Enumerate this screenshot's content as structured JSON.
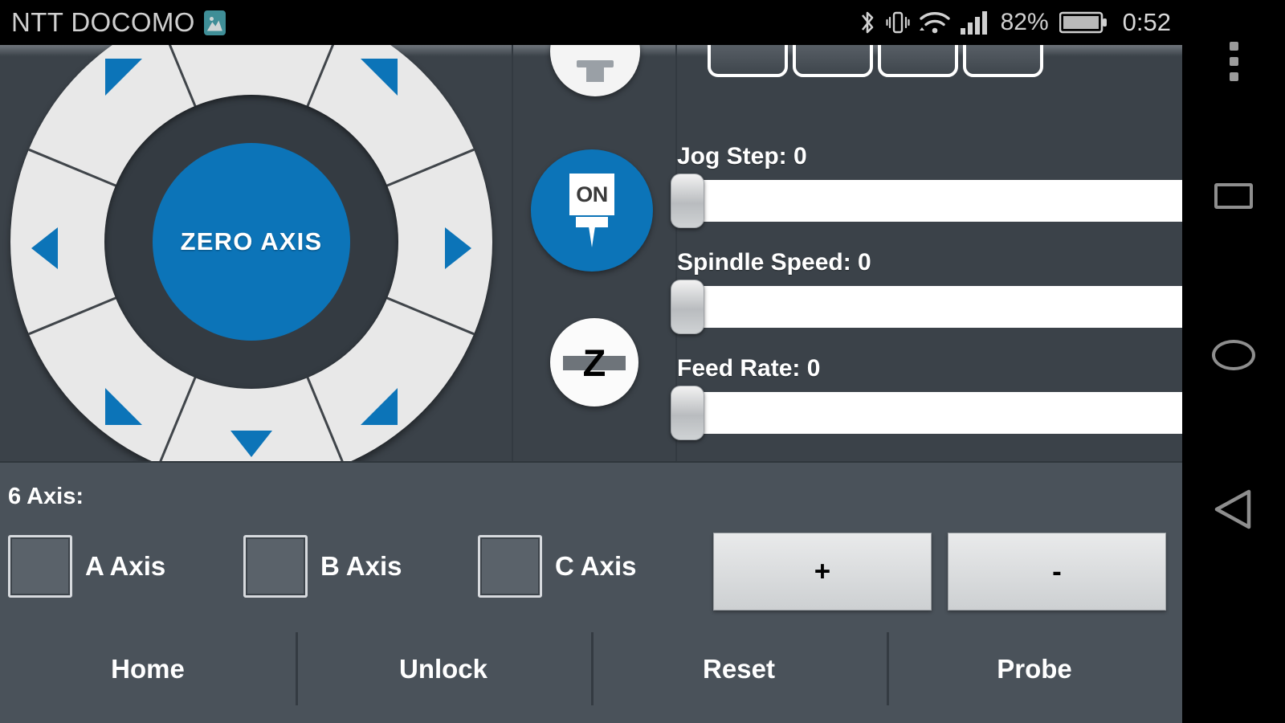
{
  "statusbar": {
    "carrier": "NTT DOCOMO",
    "battery_percent": "82%",
    "clock": "0:52",
    "icons": [
      "photo-icon",
      "bluetooth-icon",
      "vibrate-icon",
      "wifi-icon",
      "signal-icon",
      "battery-icon"
    ]
  },
  "jog_wheel": {
    "center_label": "ZERO AXIS",
    "directions": [
      "up-left",
      "up",
      "up-right",
      "left",
      "right",
      "down-left",
      "down",
      "down-right"
    ],
    "accent_color": "#0c74b8",
    "ring_color": "#e8e8e8",
    "hub_color": "#343b42"
  },
  "tool_column": {
    "tool_top_icon": "tool-change-icon",
    "spindle_label": "ON",
    "spindle_icon": "spindle-on-icon",
    "zprobe_label": "Z",
    "zprobe_icon": "z-probe-icon"
  },
  "top_buttons": [
    {
      "name": "preset-button-1"
    },
    {
      "name": "preset-button-2"
    },
    {
      "name": "preset-button-3"
    },
    {
      "name": "preset-button-4"
    }
  ],
  "sliders": [
    {
      "label": "Jog Step: 0",
      "name": "jog-step",
      "value": 0
    },
    {
      "label": "Spindle Speed: 0",
      "name": "spindle-speed",
      "value": 0
    },
    {
      "label": "Feed Rate: 0",
      "name": "feed-rate",
      "value": 0
    }
  ],
  "axis_section": {
    "title": "6 Axis:",
    "checkboxes": [
      {
        "label": "A Axis",
        "checked": false
      },
      {
        "label": "B Axis",
        "checked": false
      },
      {
        "label": "C Axis",
        "checked": false
      }
    ],
    "increment_label": "+",
    "decrement_label": "-"
  },
  "action_buttons": [
    {
      "label": "Home"
    },
    {
      "label": "Unlock"
    },
    {
      "label": "Reset"
    },
    {
      "label": "Probe"
    }
  ],
  "navbar": {
    "overflow": "overflow-menu-icon",
    "recents": "recents-square-icon",
    "home": "home-circle-icon",
    "back": "back-triangle-icon"
  },
  "colors": {
    "accent": "#0c74b8",
    "panel_top": "#3b4249",
    "panel_bottom": "#4a525a",
    "text": "#ffffff"
  }
}
